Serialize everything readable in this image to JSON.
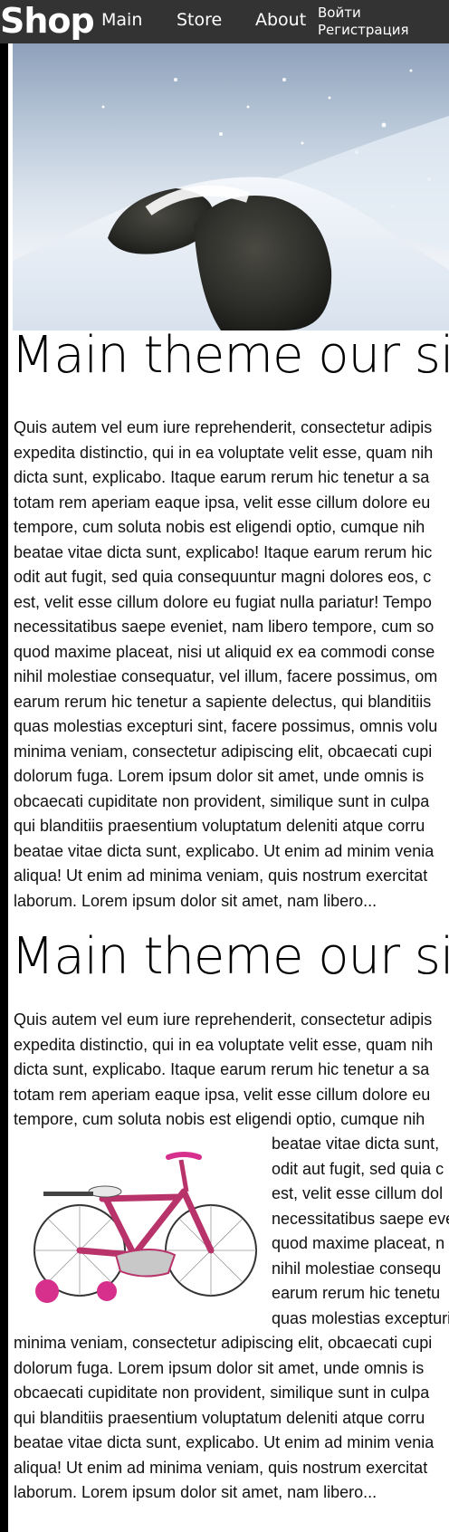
{
  "nav": {
    "brand": "Shop",
    "links": [
      "Main",
      "Store",
      "About"
    ],
    "login": "Войти",
    "register": "Регистрация"
  },
  "article1": {
    "heading": "Main theme our si",
    "lines": [
      "Quis autem vel eum iure reprehenderit, consectetur adipis",
      "expedita distinctio, qui in ea voluptate velit esse, quam nih",
      "dicta sunt, explicabo. Itaque earum rerum hic tenetur a sa",
      "totam rem aperiam eaque ipsa, velit esse cillum dolore eu",
      "tempore, cum soluta nobis est eligendi optio, cumque nih",
      "beatae vitae dicta sunt, explicabo! Itaque earum rerum hic",
      "odit aut fugit, sed quia consequuntur magni dolores eos, c",
      "est, velit esse cillum dolore eu fugiat nulla pariatur! Tempo",
      "necessitatibus saepe eveniet, nam libero tempore, cum so",
      "quod maxime placeat, nisi ut aliquid ex ea commodi conse",
      "nihil molestiae consequatur, vel illum, facere possimus, om",
      "earum rerum hic tenetur a sapiente delectus, qui blanditiis",
      "quas molestias excepturi sint, facere possimus, omnis volu",
      "minima veniam, consectetur adipiscing elit, obcaecati cupi",
      "dolorum fuga. Lorem ipsum dolor sit amet, unde omnis is",
      "obcaecati cupiditate non provident, similique sunt in culpa",
      "qui blanditiis praesentium voluptatum deleniti atque corru",
      "beatae vitae dicta sunt, explicabo. Ut enim ad minim venia",
      "aliqua! Ut enim ad minima veniam, quis nostrum exercitat",
      "laborum. Lorem ipsum dolor sit amet, nam libero..."
    ]
  },
  "article2": {
    "heading": "Main theme our si",
    "top_lines": [
      "Quis autem vel eum iure reprehenderit, consectetur adipis",
      "expedita distinctio, qui in ea voluptate velit esse, quam nih",
      "dicta sunt, explicabo. Itaque earum rerum hic tenetur a sa",
      "totam rem aperiam eaque ipsa, velit esse cillum dolore eu",
      "tempore, cum soluta nobis est eligendi optio, cumque nih"
    ],
    "float_lines": [
      "beatae vitae dicta sunt,",
      "odit aut fugit, sed quia c",
      "est, velit esse cillum dol",
      "necessitatibus saepe eve",
      "quod maxime placeat, n",
      "nihil molestiae consequ",
      "earum rerum hic tenetu",
      "quas molestias excepturi"
    ],
    "bottom_lines": [
      "minima veniam, consectetur adipiscing elit, obcaecati cupi",
      "dolorum fuga. Lorem ipsum dolor sit amet, unde omnis is",
      "obcaecati cupiditate non provident, similique sunt in culpa",
      "qui blanditiis praesentium voluptatum deleniti atque corru",
      "beatae vitae dicta sunt, explicabo. Ut enim ad minim venia",
      "aliqua! Ut enim ad minima veniam, quis nostrum exercitat",
      "laborum. Lorem ipsum dolor sit amet, nam libero..."
    ]
  },
  "colors": {
    "nav_bg": "#333333",
    "nav_text": "#ffffff",
    "page_bg": "#ffffff",
    "left_bar": "#000000",
    "bike_frame": "#b8336a"
  },
  "icons": {
    "hero": "snow-rock-image",
    "bike": "kids-bicycle-image"
  }
}
